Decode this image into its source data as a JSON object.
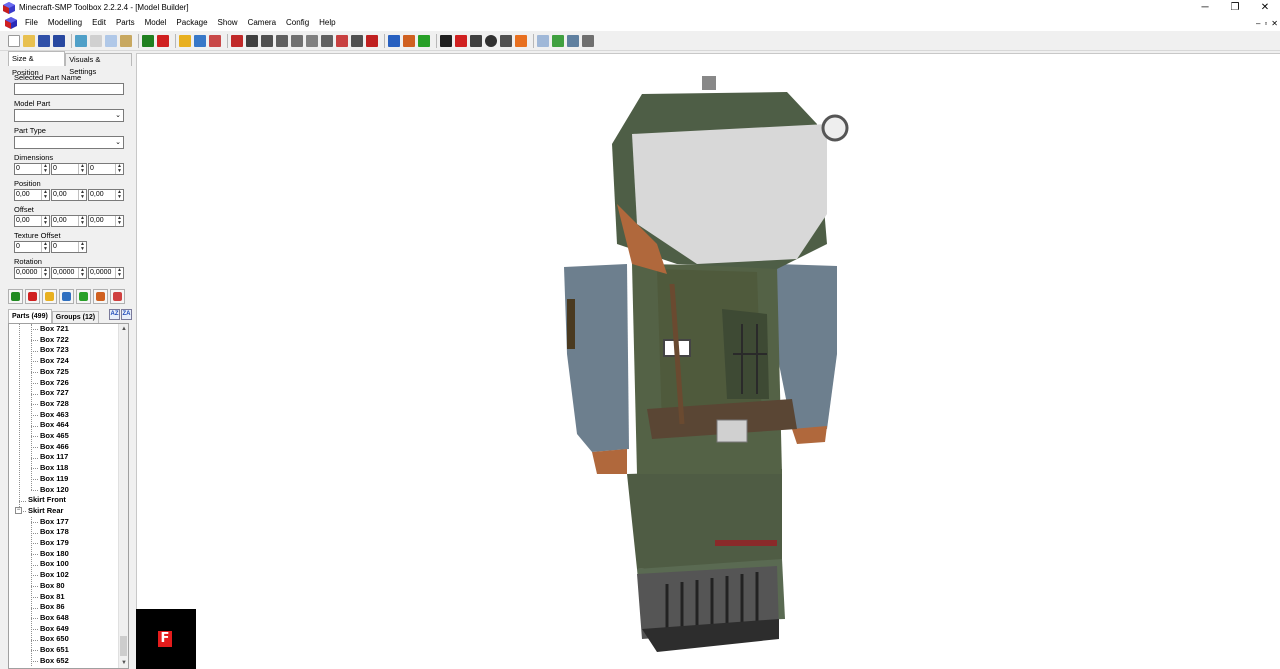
{
  "window": {
    "title": "Minecraft-SMP Toolbox 2.2.2.4 - [Model Builder]",
    "controls": {
      "minimize": "─",
      "restore": "❐",
      "close": "✕"
    }
  },
  "menu": {
    "items": [
      "File",
      "Modelling",
      "Edit",
      "Parts",
      "Model",
      "Package",
      "Show",
      "Camera",
      "Config",
      "Help"
    ],
    "mdi_controls": {
      "minimize": "–",
      "restore": "▫",
      "close": "✕"
    }
  },
  "panel": {
    "tabs": [
      "Size & Position",
      "Visuals & Settings"
    ],
    "selected_part_name_label": "Selected Part Name",
    "selected_part_name_value": "",
    "model_part_label": "Model Part",
    "model_part_value": "",
    "part_type_label": "Part Type",
    "part_type_value": "",
    "dimensions_label": "Dimensions",
    "dimensions": [
      "0",
      "0",
      "0"
    ],
    "position_label": "Position",
    "position": [
      "0,00",
      "0,00",
      "0,00"
    ],
    "offset_label": "Offset",
    "offset": [
      "0,00",
      "0,00",
      "0,00"
    ],
    "texture_offset_label": "Texture Offset",
    "texture_offset": [
      "0",
      "0"
    ],
    "rotation_label": "Rotation",
    "rotation": [
      "0,0000",
      "0,0000",
      "0,0000"
    ]
  },
  "tree": {
    "tabs": [
      "Parts (499)",
      "Groups (12)"
    ],
    "sort_buttons": [
      "AZ",
      "ZA"
    ],
    "rows": [
      {
        "label": "Box 721",
        "level": 2
      },
      {
        "label": "Box 722",
        "level": 2
      },
      {
        "label": "Box 723",
        "level": 2
      },
      {
        "label": "Box 724",
        "level": 2
      },
      {
        "label": "Box 725",
        "level": 2
      },
      {
        "label": "Box 726",
        "level": 2
      },
      {
        "label": "Box 727",
        "level": 2
      },
      {
        "label": "Box 728",
        "level": 2
      },
      {
        "label": "Box 463",
        "level": 2
      },
      {
        "label": "Box 464",
        "level": 2
      },
      {
        "label": "Box 465",
        "level": 2
      },
      {
        "label": "Box 466",
        "level": 2
      },
      {
        "label": "Box 117",
        "level": 2
      },
      {
        "label": "Box 118",
        "level": 2
      },
      {
        "label": "Box 119",
        "level": 2
      },
      {
        "label": "Box 120",
        "level": 2
      },
      {
        "label": "Skirt Front",
        "level": 1
      },
      {
        "label": "Skirt Rear",
        "level": 1,
        "expanded": true
      },
      {
        "label": "Box 177",
        "level": 2
      },
      {
        "label": "Box 178",
        "level": 2
      },
      {
        "label": "Box 179",
        "level": 2
      },
      {
        "label": "Box 180",
        "level": 2
      },
      {
        "label": "Box 100",
        "level": 2
      },
      {
        "label": "Box 102",
        "level": 2
      },
      {
        "label": "Box 80",
        "level": 2
      },
      {
        "label": "Box 81",
        "level": 2
      },
      {
        "label": "Box 86",
        "level": 2
      },
      {
        "label": "Box 648",
        "level": 2
      },
      {
        "label": "Box 649",
        "level": 2
      },
      {
        "label": "Box 650",
        "level": 2
      },
      {
        "label": "Box 651",
        "level": 2
      },
      {
        "label": "Box 652",
        "level": 2
      }
    ]
  },
  "viewport": {
    "logo_letter": "F"
  },
  "colors": {
    "helmet_green": "#4e5e46",
    "visor_white": "#d8d8d8",
    "arm_camo_blue": "#6d7f8e",
    "vest_green": "#4f5a3c",
    "skin": "#b0683c",
    "boot_gray": "#505050",
    "logo_red": "#e41c1c"
  }
}
